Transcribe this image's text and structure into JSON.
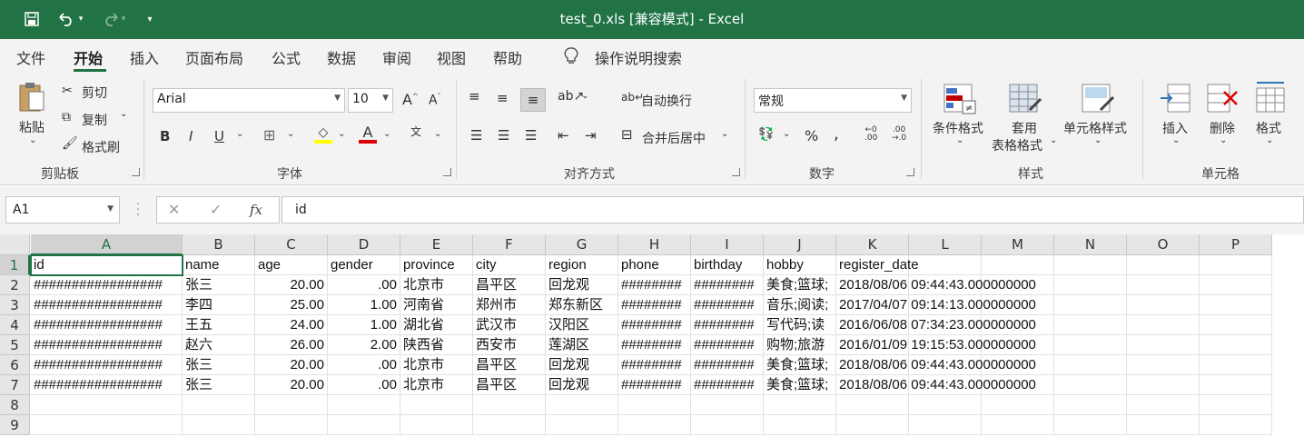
{
  "titlebar": {
    "title": "test_0.xls  [兼容模式]  -  Excel"
  },
  "tabs": [
    "文件",
    "开始",
    "插入",
    "页面布局",
    "公式",
    "数据",
    "审阅",
    "视图",
    "帮助"
  ],
  "tell_me": "操作说明搜索",
  "ribbon": {
    "clipboard": {
      "paste": "粘贴",
      "cut": "剪切",
      "copy": "复制",
      "format_painter": "格式刷",
      "label": "剪贴板"
    },
    "font": {
      "name": "Arial",
      "size": "10",
      "bold": "B",
      "italic": "I",
      "underline": "U",
      "label": "字体"
    },
    "alignment": {
      "wrap": "自动换行",
      "merge": "合并后居中",
      "label": "对齐方式"
    },
    "number": {
      "format": "常规",
      "label": "数字"
    },
    "styles": {
      "conditional": "条件格式",
      "table_1": "套用",
      "table_2": "表格格式",
      "cell_styles": "单元格样式",
      "label": "样式"
    },
    "cells": {
      "insert": "插入",
      "delete": "删除",
      "format": "格式",
      "label": "单元格"
    }
  },
  "formula_bar": {
    "name_box": "A1",
    "fx": "fx",
    "formula": "id"
  },
  "sheet": {
    "columns": [
      "A",
      "B",
      "C",
      "D",
      "E",
      "F",
      "G",
      "H",
      "I",
      "J",
      "K",
      "L",
      "M",
      "N",
      "O",
      "P"
    ],
    "rows": [
      "1",
      "2",
      "3",
      "4",
      "5",
      "6",
      "7",
      "8",
      "9"
    ],
    "data": [
      [
        "id",
        "name",
        "age",
        "gender",
        "province",
        "city",
        "region",
        "phone",
        "birthday",
        "hobby",
        "register_date"
      ],
      [
        "#################",
        "张三",
        "20.00",
        ".00",
        "北京市",
        "昌平区",
        "回龙观",
        "########",
        "########",
        "美食;篮球;",
        "2018/08/06 09:44:43.000000000"
      ],
      [
        "#################",
        "李四",
        "25.00",
        "1.00",
        "河南省",
        "郑州市",
        "郑东新区",
        "########",
        "########",
        "音乐;阅读;",
        "2017/04/07 09:14:13.000000000"
      ],
      [
        "#################",
        "王五",
        "24.00",
        "1.00",
        "湖北省",
        "武汉市",
        "汉阳区",
        "########",
        "########",
        "写代码;读",
        "2016/06/08 07:34:23.000000000"
      ],
      [
        "#################",
        "赵六",
        "26.00",
        "2.00",
        "陕西省",
        "西安市",
        "莲湖区",
        "########",
        "########",
        "购物;旅游",
        "2016/01/09 19:15:53.000000000"
      ],
      [
        "#################",
        "张三",
        "20.00",
        ".00",
        "北京市",
        "昌平区",
        "回龙观",
        "########",
        "########",
        "美食;篮球;",
        "2018/08/06 09:44:43.000000000"
      ],
      [
        "#################",
        "张三",
        "20.00",
        ".00",
        "北京市",
        "昌平区",
        "回龙观",
        "########",
        "########",
        "美食;篮球;",
        "2018/08/06 09:44:43.000000000"
      ]
    ]
  }
}
